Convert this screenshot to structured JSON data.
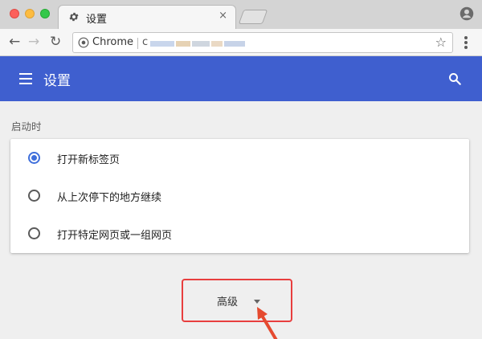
{
  "browser": {
    "tab_title": "设置",
    "tab_close": "×",
    "omnibox_label": "Chrome",
    "omnibox_url": "c",
    "back_glyph": "←",
    "forward_glyph": "→",
    "reload_glyph": "↻",
    "star_glyph": "☆"
  },
  "header": {
    "title": "设置"
  },
  "startup": {
    "heading": "启动时",
    "options": [
      {
        "label": "打开新标签页",
        "checked": true
      },
      {
        "label": "从上次停下的地方继续",
        "checked": false
      },
      {
        "label": "打开特定网页或一组网页",
        "checked": false
      }
    ]
  },
  "advanced": {
    "label": "高级"
  },
  "colors": {
    "appbar": "#3f5fcf",
    "radio_checked": "#3f6fdb",
    "highlight": "#e83e3e"
  }
}
